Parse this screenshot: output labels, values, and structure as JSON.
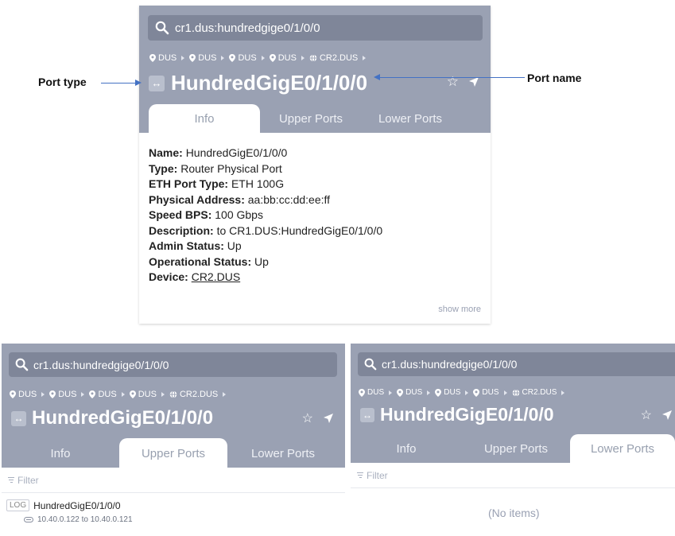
{
  "search_query": "cr1.dus:hundredgige0/1/0/0",
  "breadcrumbs": [
    "DUS",
    "DUS",
    "DUS",
    "DUS",
    "CR2.DUS"
  ],
  "port_title": "HundredGigE0/1/0/0",
  "tabs": [
    "Info",
    "Upper Ports",
    "Lower Ports"
  ],
  "annotations": {
    "port_type": "Port type",
    "port_name": "Port name"
  },
  "info": [
    {
      "label": "Name:",
      "value": "HundredGigE0/1/0/0"
    },
    {
      "label": "Type:",
      "value": "Router Physical Port"
    },
    {
      "label": "ETH Port Type:",
      "value": "ETH 100G"
    },
    {
      "label": "Physical Address:",
      "value": "aa:bb:cc:dd:ee:ff"
    },
    {
      "label": "Speed BPS:",
      "value": "100 Gbps"
    },
    {
      "label": "Description:",
      "value": "to CR1.DUS:HundredGigE0/1/0/0"
    },
    {
      "label": "Admin Status:",
      "value": "Up"
    },
    {
      "label": "Operational Status:",
      "value": "Up"
    },
    {
      "label": "Device:",
      "value": "CR2.DUS"
    }
  ],
  "show_more": "show more",
  "filter_placeholder": "Filter",
  "upper_ports": [
    {
      "badge": "LOG",
      "name": "HundredGigE0/1/0/0",
      "link": "10.40.0.122 to 10.40.0.121"
    }
  ],
  "no_items": "(No items)",
  "colors": {
    "header_bg": "#9aa1b3",
    "search_bg": "#7f8699",
    "arrow": "#4472c4"
  },
  "icons": {
    "search": "search-icon",
    "breadcrumb_location": "location-pin-icon",
    "breadcrumb_device": "globe-icon",
    "port_type": "port-type-icon",
    "favorite": "star-icon",
    "locate": "navigate-arrow-icon",
    "filter": "filter-icon",
    "link": "link-icon"
  }
}
